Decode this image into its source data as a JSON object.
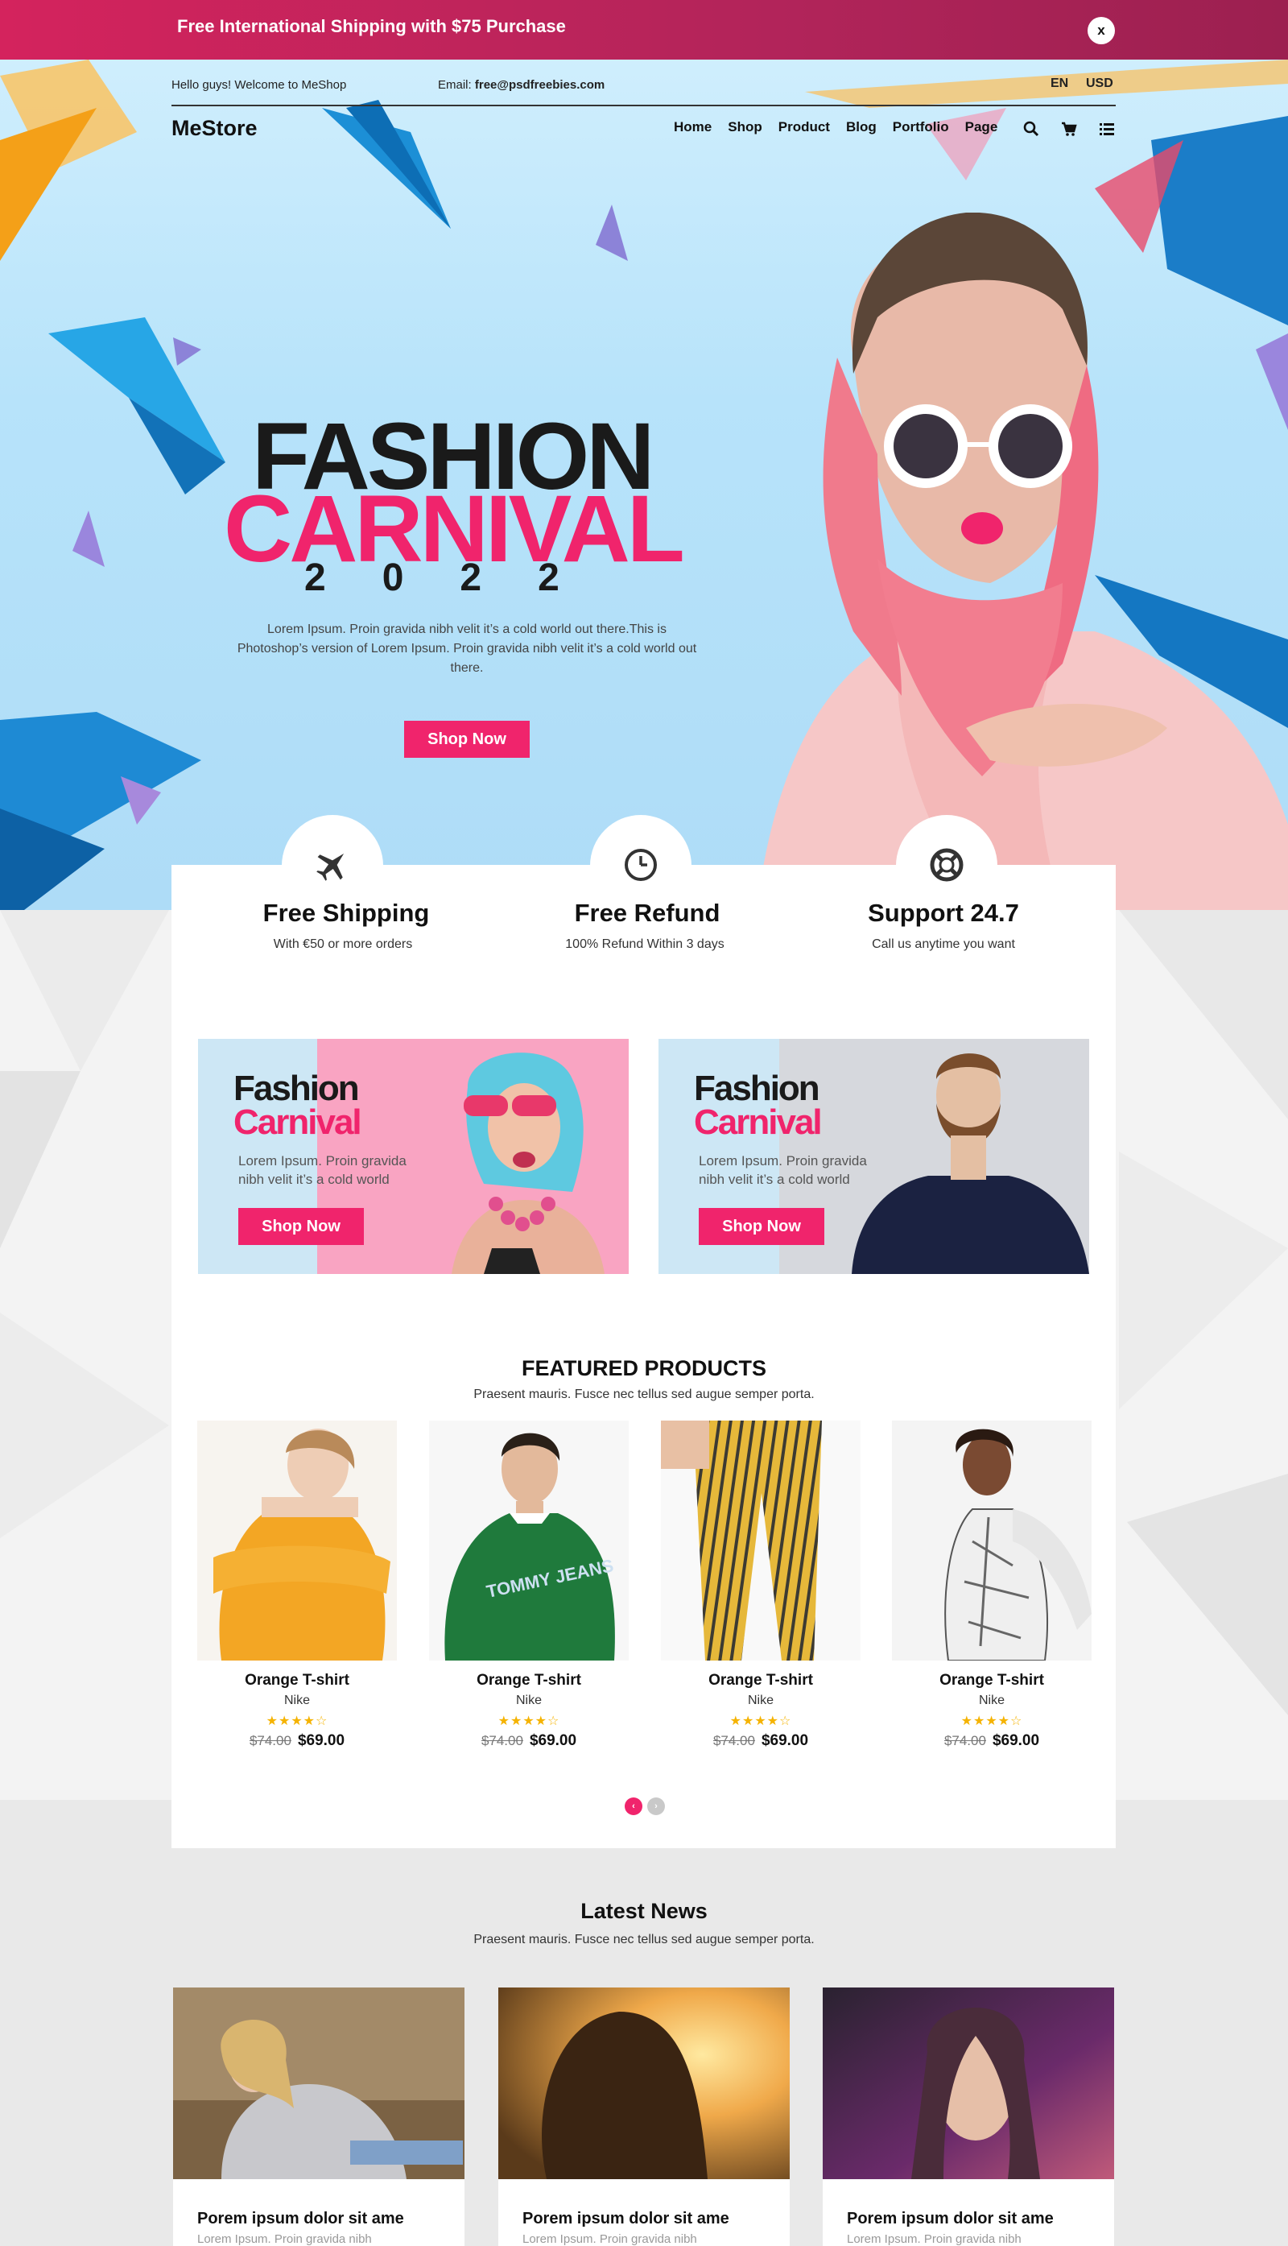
{
  "promo": {
    "text": "Free International Shipping with $75 Purchase",
    "close_label": "x"
  },
  "topbar": {
    "welcome": "Hello guys! Welcome to MeShop",
    "email_label": "Email:",
    "email_value": "free@psdfreebies.com",
    "language": "EN",
    "currency": "USD"
  },
  "nav": {
    "logo": "MeStore",
    "items": [
      "Home",
      "Shop",
      "Product",
      "Blog",
      "Portfolio",
      "Page"
    ],
    "icons": [
      "search-icon",
      "cart-icon",
      "list-menu-icon"
    ]
  },
  "hero": {
    "title_line1": "FASHION",
    "title_line2": "CARNIVAL",
    "year": "2022",
    "description": "Lorem Ipsum. Proin gravida nibh velit it’s a cold world out there.This is Photoshop’s version of Lorem Ipsum. Proin gravida nibh velit it’s a cold world out there.",
    "button": "Shop Now"
  },
  "features": [
    {
      "icon": "airplane-icon",
      "title": "Free Shipping",
      "subtitle": "With €50 or more orders"
    },
    {
      "icon": "clock-icon",
      "title": "Free Refund",
      "subtitle": "100% Refund Within 3 days"
    },
    {
      "icon": "lifebuoy-icon",
      "title": "Support 24.7",
      "subtitle": "Call us anytime you want"
    }
  ],
  "banners": [
    {
      "title_line1": "Fashion",
      "title_line2": "Carnival",
      "description": "Lorem Ipsum. Proin gravida nibh velit it’s a cold world",
      "button": "Shop Now"
    },
    {
      "title_line1": "Fashion",
      "title_line2": "Carnival",
      "description": "Lorem Ipsum. Proin gravida nibh velit it’s a cold world",
      "button": "Shop Now"
    }
  ],
  "featured": {
    "title": "FEATURED PRODUCTS",
    "subtitle": "Praesent mauris. Fusce nec tellus sed augue semper porta.",
    "products": [
      {
        "name": "Orange T-shirt",
        "brand": "Nike",
        "rating": 4,
        "old_price": "$74.00",
        "price": "$69.00"
      },
      {
        "name": "Orange T-shirt",
        "brand": "Nike",
        "rating": 4,
        "old_price": "$74.00",
        "price": "$69.00"
      },
      {
        "name": "Orange T-shirt",
        "brand": "Nike",
        "rating": 4,
        "old_price": "$74.00",
        "price": "$69.00"
      },
      {
        "name": "Orange T-shirt",
        "brand": "Nike",
        "rating": 4,
        "old_price": "$74.00",
        "price": "$69.00"
      }
    ],
    "pager": {
      "prev": "‹",
      "next": "›"
    }
  },
  "news": {
    "title": "Latest News",
    "subtitle": "Praesent mauris. Fusce nec tellus sed augue semper porta.",
    "items": [
      {
        "title": "Porem ipsum dolor sit ame",
        "excerpt": "Lorem Ipsum. Proin gravida nibh"
      },
      {
        "title": "Porem ipsum dolor sit ame",
        "excerpt": "Lorem Ipsum. Proin gravida nibh"
      },
      {
        "title": "Porem ipsum dolor sit ame",
        "excerpt": "Lorem Ipsum. Proin gravida nibh"
      }
    ]
  },
  "colors": {
    "accent": "#f0246c",
    "promo_bg": "#b2245a",
    "hero_bg": "#b7e3fa",
    "star": "#f5b301"
  }
}
